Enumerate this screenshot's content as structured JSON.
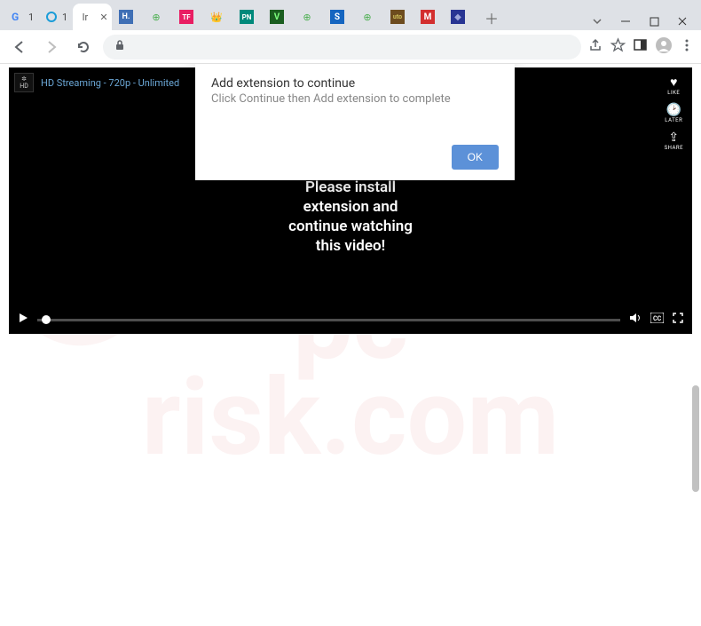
{
  "window": {
    "tabs": [
      {
        "favicon": "G",
        "favcolor": "#4285f4",
        "title": "1"
      },
      {
        "favicon": "◉",
        "favcolor": "#1a73e8",
        "title": "1"
      },
      {
        "favicon": "lr",
        "favcolor": "#555",
        "title": "",
        "active": true
      },
      {
        "favicon": "H",
        "favcolor": "#3f6fb5",
        "title": ""
      },
      {
        "favicon": "⊕",
        "favcolor": "#4caf50",
        "title": ""
      },
      {
        "favicon": "TF",
        "favcolor": "#e91e63",
        "title": ""
      },
      {
        "favicon": "👑",
        "favcolor": "#ff9800",
        "title": ""
      },
      {
        "favicon": "PN",
        "favcolor": "#00897b",
        "title": ""
      },
      {
        "favicon": "V",
        "favcolor": "#2e7d32",
        "title": ""
      },
      {
        "favicon": "⊕",
        "favcolor": "#4caf50",
        "title": ""
      },
      {
        "favicon": "S",
        "favcolor": "#1565c0",
        "title": ""
      },
      {
        "favicon": "⊕",
        "favcolor": "#4caf50",
        "title": ""
      },
      {
        "favicon": "💿",
        "favcolor": "#8d6e63",
        "title": ""
      },
      {
        "favicon": "M",
        "favcolor": "#d32f2f",
        "title": ""
      },
      {
        "favicon": "◆",
        "favcolor": "#283593",
        "title": ""
      }
    ]
  },
  "toolbar": {
    "address_value": ""
  },
  "video": {
    "header_title": "HD Streaming - 720p - Unlimited",
    "message_l1": "Please install",
    "message_l2": "extension and",
    "message_l3": "continue watching",
    "message_l4": "this video!",
    "side_like": "LIKE",
    "side_later": "LATER",
    "side_share": "SHARE"
  },
  "dialog": {
    "title": "Add extension to continue",
    "subtitle": "Click Continue then Add extension to complete",
    "ok_label": "OK"
  },
  "watermark": {
    "text_top": "pc",
    "text_bottom": "risk.com"
  }
}
